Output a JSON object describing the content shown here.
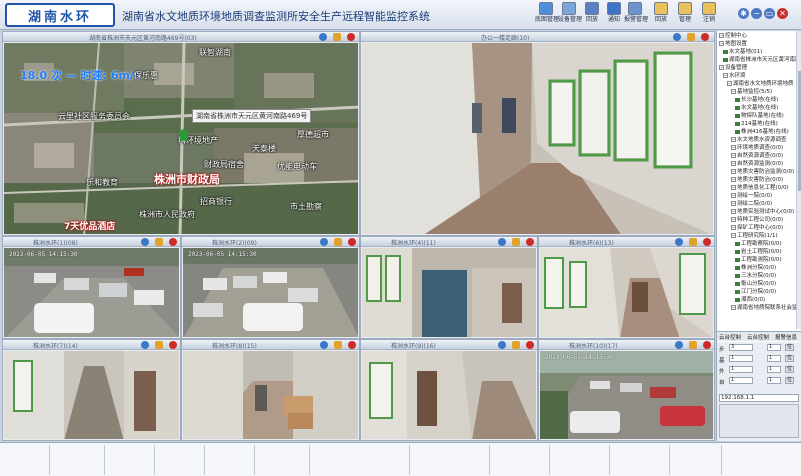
{
  "app": {
    "logo_text": "湖南水环",
    "title": "湖南省水文地质环境地质调查监测所安全生产远程智能监控系统"
  },
  "toolbar": [
    {
      "label": "底图管理",
      "icon": "map-icon",
      "color": "#4f8fd8"
    },
    {
      "label": "设备管理",
      "icon": "device-icon",
      "color": "#7aa6d9"
    },
    {
      "label": "回放",
      "icon": "playback-icon",
      "color": "#5b7fc4"
    },
    {
      "label": "通知",
      "icon": "notice-icon",
      "color": "#3e74c6"
    },
    {
      "label": "报警管理",
      "icon": "alarm-icon",
      "color": "#6b93cf"
    },
    {
      "label": "回放",
      "icon": "folder-icon",
      "color": "#e8c15a"
    },
    {
      "label": "管理",
      "icon": "folder-icon",
      "color": "#e8c15a"
    },
    {
      "label": "注销",
      "icon": "logout-icon",
      "color": "#e8c15a"
    }
  ],
  "window_controls": {
    "minimize": "−",
    "restore": "▭",
    "close": "✕",
    "settings": "✱"
  },
  "tiles": [
    {
      "title": "湖南省株洲市天元区黄河南路469号(03)",
      "scene": "map"
    },
    {
      "title": "办公一楼走廊(10)",
      "scene": "corridor"
    },
    {
      "title": "株洲水环(1)(08)",
      "scene": "parking",
      "stamp": "2023-06-05 14:15:30"
    },
    {
      "title": "株洲水环(2)(09)",
      "scene": "parking",
      "stamp": "2023-06-05 14:15:30"
    },
    {
      "title": "株洲水环(4)(11)",
      "scene": "stair"
    },
    {
      "title": "株洲水环(6)(13)",
      "scene": "hall"
    },
    {
      "title": "株洲水环(7)(14)",
      "scene": "stair"
    },
    {
      "title": "株洲水环(8)(15)",
      "scene": "hall"
    },
    {
      "title": "株洲水环(9)(16)",
      "scene": "stair"
    },
    {
      "title": "株洲水环(10)(17)",
      "scene": "parking",
      "stamp": "2023-06-05 14:15:30"
    }
  ],
  "map_overlay": {
    "speed": "18.0 次 — 时速: 6m/s",
    "address": "湖南省株洲市天元区黄河南路469号",
    "labels": [
      "联智湖南",
      "保乐惠",
      "云里社区服务委员会",
      "科环境地产",
      "天泰楼",
      "厚德超市",
      "财政局宿舍",
      "优能电动车",
      "乐和教育",
      "招商银行",
      "株洲市人民政府",
      "市土勘察",
      "7天优品酒店",
      "株洲市财政局",
      "智地"
    ],
    "big_label": "株洲市财政局",
    "hotel_label": "7天优品酒店"
  },
  "tree": [
    {
      "label": "控制中心",
      "level": 0,
      "type": "node"
    },
    {
      "label": "地图设置",
      "level": 0,
      "type": "node"
    },
    {
      "label": "水文基地(01)",
      "level": 1,
      "type": "cam"
    },
    {
      "label": "湖南省株洲市天元区黄河南路",
      "level": 1,
      "type": "cam"
    },
    {
      "label": "设备管理",
      "level": 0,
      "type": "node"
    },
    {
      "label": "水环境",
      "level": 1,
      "type": "node"
    },
    {
      "label": "湖南省水文地质环境地质",
      "level": 2,
      "type": "node"
    },
    {
      "label": "基地监控(5/5)",
      "level": 3,
      "type": "node"
    },
    {
      "label": "长沙基地(在线)",
      "level": 4,
      "type": "cam"
    },
    {
      "label": "水文基地(在线)",
      "level": 4,
      "type": "cam"
    },
    {
      "label": "物探队基地(在线)",
      "level": 4,
      "type": "cam"
    },
    {
      "label": "214基地(在线)",
      "level": 4,
      "type": "cam"
    },
    {
      "label": "株洲416基地(在线)",
      "level": 4,
      "type": "cam"
    },
    {
      "label": "水文地质水资源调查",
      "level": 3,
      "type": "node"
    },
    {
      "label": "环境地质调查(0/0)",
      "level": 3,
      "type": "node"
    },
    {
      "label": "自然资源调查(0/0)",
      "level": 3,
      "type": "node"
    },
    {
      "label": "自然资源监测(0/0)",
      "level": 3,
      "type": "node"
    },
    {
      "label": "地质灾害防治监测(0/0)",
      "level": 3,
      "type": "node"
    },
    {
      "label": "地质灾害防治(0/0)",
      "level": 3,
      "type": "node"
    },
    {
      "label": "地质信息化工程(0/0)",
      "level": 3,
      "type": "node"
    },
    {
      "label": "测绘一院(0/0)",
      "level": 3,
      "type": "node"
    },
    {
      "label": "测绘二院(0/0)",
      "level": 3,
      "type": "node"
    },
    {
      "label": "地质实验测试中心(0/0)",
      "level": 3,
      "type": "node"
    },
    {
      "label": "特种工程公司(0/0)",
      "level": 3,
      "type": "node"
    },
    {
      "label": "探矿工程中心(0/0)",
      "level": 3,
      "type": "node"
    },
    {
      "label": "工程研究院(1/1)",
      "level": 3,
      "type": "node"
    },
    {
      "label": "工程勘察院(0/0)",
      "level": 4,
      "type": "cam"
    },
    {
      "label": "岩土工程院(0/0)",
      "level": 4,
      "type": "cam"
    },
    {
      "label": "工程勘测院(0/0)",
      "level": 4,
      "type": "cam"
    },
    {
      "label": "株洲分院(0/0)",
      "level": 4,
      "type": "cam"
    },
    {
      "label": "三水分院(0/0)",
      "level": 4,
      "type": "cam"
    },
    {
      "label": "衡山分院(0/0)",
      "level": 4,
      "type": "cam"
    },
    {
      "label": "江门分院(0/0)",
      "level": 4,
      "type": "cam"
    },
    {
      "label": "湘西(0/0)",
      "level": 4,
      "type": "cam"
    },
    {
      "label": "湖南省地质院联系社会监控",
      "level": 3,
      "type": "node"
    }
  ],
  "panel_tabs": [
    "云台控制",
    "云台控制",
    "报警信息"
  ],
  "ptz": {
    "row1": [
      "步",
      "3",
      "1",
      "位"
    ],
    "row2": [
      "基",
      "1",
      "1",
      "位"
    ],
    "row3": [
      "外",
      "1",
      "1",
      "位"
    ],
    "row4": [
      "自",
      "1",
      "1",
      "位"
    ],
    "ip": "192.168.1.1"
  }
}
